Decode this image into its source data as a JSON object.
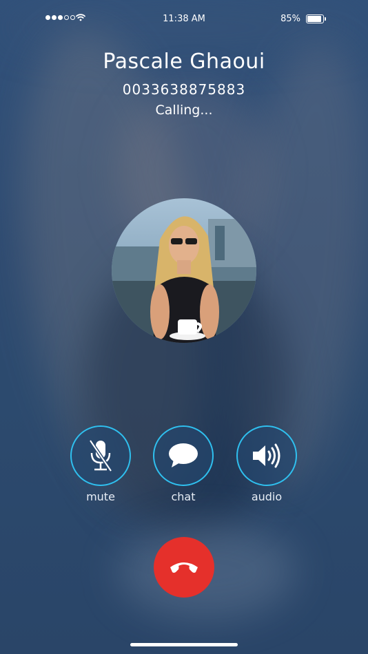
{
  "status_bar": {
    "time": "11:38 AM",
    "battery_percent": "85%",
    "battery_level": 0.85,
    "signal_bars_filled": 3,
    "signal_bars_total": 5,
    "icons": [
      "signal-dots-icon",
      "wifi-icon",
      "battery-icon"
    ]
  },
  "caller": {
    "name": "Pascale Ghaoui",
    "number": "0033638875883",
    "status": "Calling..."
  },
  "controls": [
    {
      "label": "mute",
      "icon": "microphone-muted-icon"
    },
    {
      "label": "chat",
      "icon": "speech-bubble-icon"
    },
    {
      "label": "audio",
      "icon": "speaker-icon"
    }
  ],
  "end_call": {
    "icon": "phone-hangup-icon"
  },
  "colors": {
    "background": "#2f4d73",
    "control_border": "#2fc0ef",
    "hangup": "#e5302b",
    "text": "#ffffff"
  }
}
